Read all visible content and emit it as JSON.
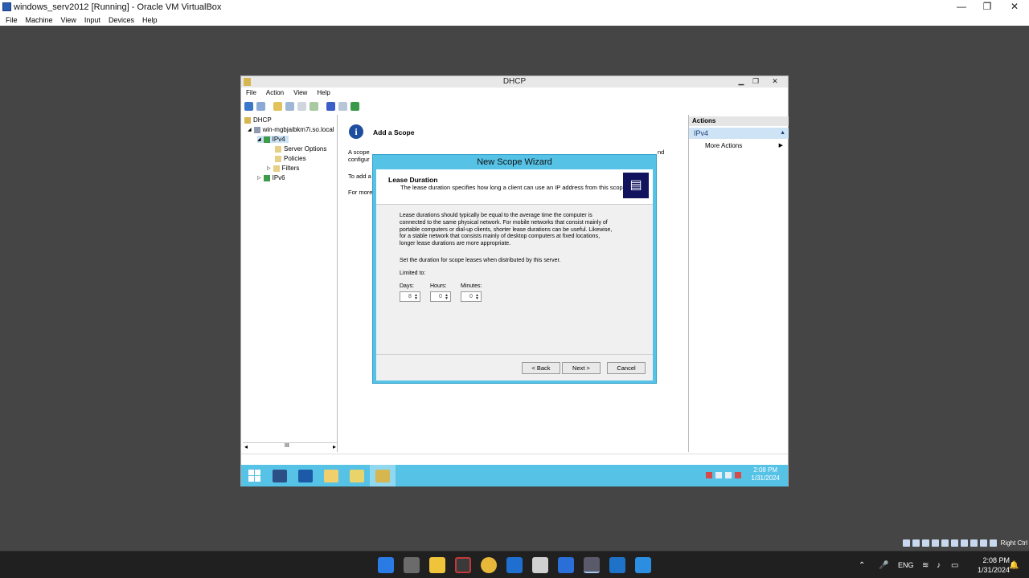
{
  "host": {
    "title": "windows_serv2012 [Running] - Oracle VM VirtualBox",
    "menu": [
      "File",
      "Machine",
      "View",
      "Input",
      "Devices",
      "Help"
    ],
    "controls": {
      "minimize": "—",
      "restore": "❐",
      "close": "✕"
    },
    "status_right_label": "Right Ctrl"
  },
  "dhcp": {
    "title": "DHCP",
    "menu": [
      "File",
      "Action",
      "View",
      "Help"
    ],
    "tree": {
      "root": "DHCP",
      "server": "win-mgbjaibkm7i.so.local",
      "ipv4": "IPv4",
      "server_options": "Server Options",
      "policies": "Policies",
      "filters": "Filters",
      "ipv6": "IPv6"
    },
    "content": {
      "heading": "Add a Scope",
      "line1": "A scope",
      "line1_tail": "nd",
      "line2": "configur",
      "line3": "To add a",
      "line4": "For more"
    },
    "actions": {
      "header": "Actions",
      "section": "IPv4",
      "more": "More Actions"
    },
    "tree_scroll_label": "III"
  },
  "wizard": {
    "title": "New Scope Wizard",
    "heading": "Lease Duration",
    "subheading": "The lease duration specifies how long a client can use an IP address from this scope.",
    "description": "Lease durations should typically be equal to the average time the computer is connected to the same physical network. For mobile networks that consist mainly of portable computers or dial-up clients, shorter lease durations can be useful. Likewise, for a stable network that consists mainly of desktop computers at fixed locations, longer lease durations are more appropriate.",
    "set_duration": "Set the duration for scope leases when distributed by this server.",
    "limited_to": "Limited to:",
    "days_label": "Days:",
    "days_value": "8",
    "hours_label": "Hours:",
    "hours_value": "0",
    "minutes_label": "Minutes:",
    "minutes_value": "0",
    "back": "< Back",
    "next": "Next >",
    "cancel": "Cancel"
  },
  "vm_taskbar": {
    "time": "2:08 PM",
    "date": "1/31/2024"
  },
  "win11": {
    "lang": "ENG",
    "time": "2:08 PM",
    "date": "1/31/2024"
  }
}
